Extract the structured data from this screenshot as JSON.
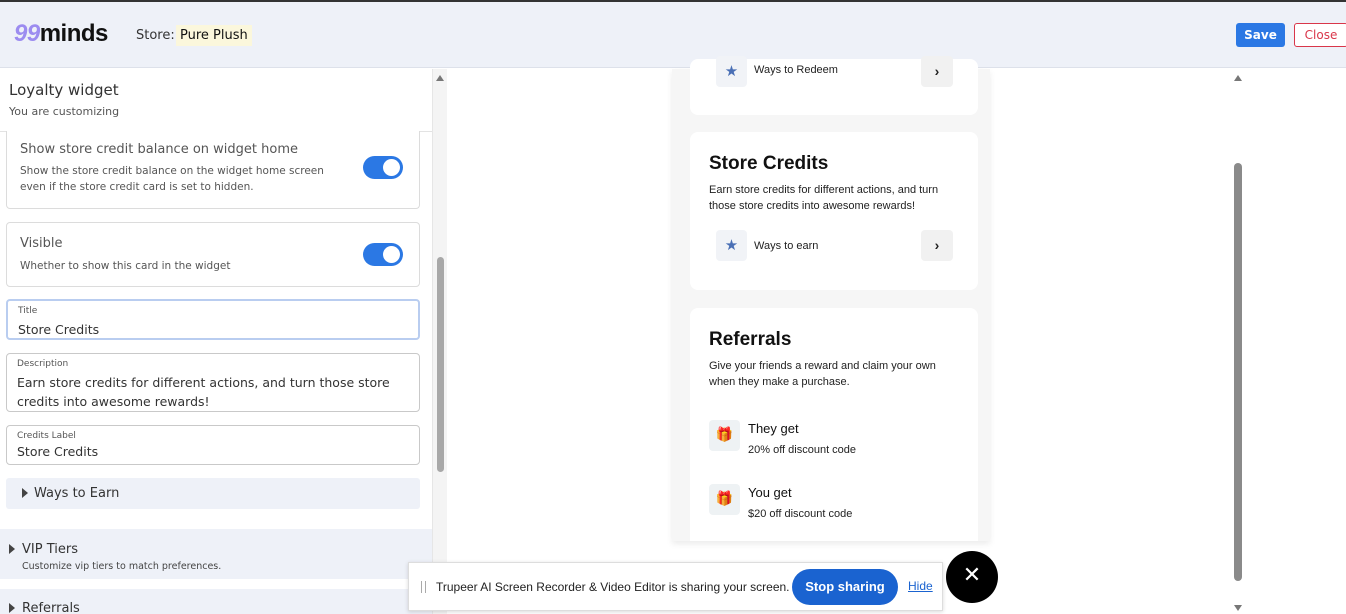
{
  "header": {
    "logo": "99minds",
    "store_label": "Store:",
    "store_name": "Pure Plush",
    "save": "Save",
    "close": "Close"
  },
  "panel": {
    "title": "Loyalty widget",
    "subtitle": "You are customizing",
    "balance": {
      "title": "Show store credit balance on widget home",
      "desc": "Show the store credit balance on the widget home screen even if the store credit card is set to hidden.",
      "on": true
    },
    "visible": {
      "title": "Visible",
      "desc": "Whether to show this card in the widget",
      "on": true
    },
    "fields": {
      "title_label": "Title",
      "title_value": "Store Credits",
      "desc_label": "Description",
      "desc_value": "Earn store credits for different actions, and turn those store credits into awesome rewards!",
      "credits_label": "Credits Label",
      "credits_value": "Store Credits"
    },
    "ways_to_earn": "Ways to Earn",
    "vip": {
      "title": "VIP Tiers",
      "desc": "Customize vip tiers to match preferences."
    },
    "referrals": "Referrals"
  },
  "preview": {
    "redeem": "Ways to Redeem",
    "store_credits": {
      "title": "Store Credits",
      "desc": "Earn store credits for different actions, and turn those store credits into awesome rewards!",
      "row": "Ways to earn"
    },
    "referrals": {
      "title": "Referrals",
      "desc": "Give your friends a reward and claim your own when they make a purchase.",
      "they_get": "They get",
      "they_value": "20% off discount code",
      "you_get": "You get",
      "you_value": "$20 off discount code"
    }
  },
  "share_bar": {
    "message": "Trupeer AI Screen Recorder & Video Editor is sharing your screen.",
    "stop": "Stop sharing",
    "hide": "Hide"
  },
  "colors": {
    "accent": "#2b78e4",
    "close": "#d9364a",
    "stop": "#1a63d0"
  }
}
